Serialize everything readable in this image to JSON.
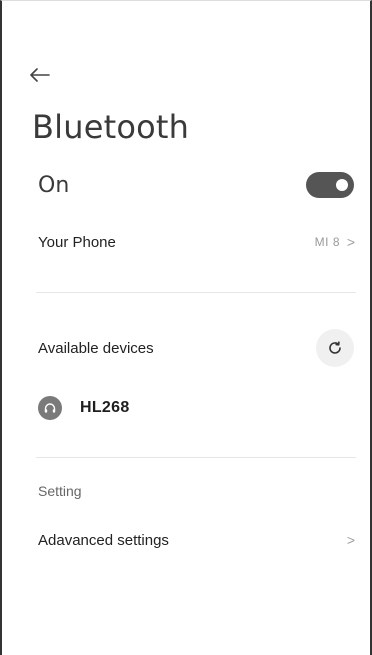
{
  "header": {
    "back_icon": "arrow-left-icon",
    "title": "Bluetooth"
  },
  "bluetooth_toggle": {
    "label": "On",
    "state": true
  },
  "your_phone": {
    "label": "Your Phone",
    "value": "MI 8",
    "chevron": ">"
  },
  "available_devices": {
    "label": "Available devices",
    "refresh_icon": "refresh-icon",
    "devices": [
      {
        "name": "HL268",
        "icon": "headphones-icon"
      }
    ]
  },
  "settings_section": {
    "heading": "Setting",
    "items": [
      {
        "label": "Adavanced settings",
        "chevron": ">"
      }
    ]
  },
  "colors": {
    "toggle_on": "#555555",
    "divider": "#e6e6e6",
    "secondary_text": "#9a9a9a"
  }
}
